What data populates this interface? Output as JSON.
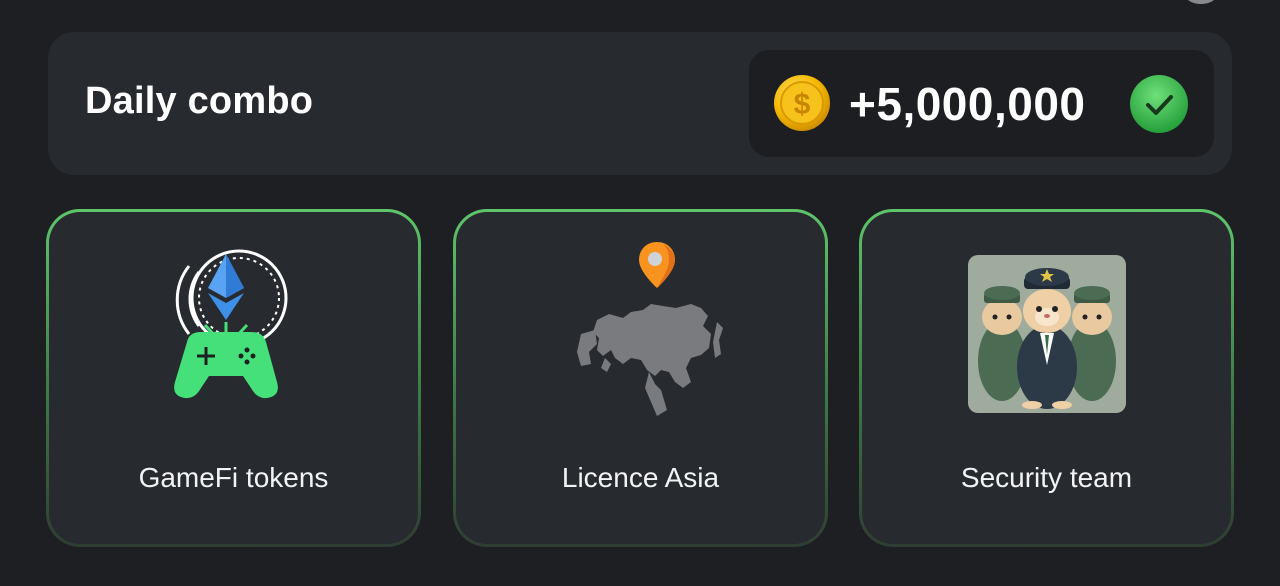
{
  "combo": {
    "title": "Daily combo",
    "reward": "+5,000,000",
    "completed": true
  },
  "cards": [
    {
      "label": "GameFi tokens",
      "icon": "gamefi-controller-icon"
    },
    {
      "label": "Licence Asia",
      "icon": "asia-map-icon"
    },
    {
      "label": "Security team",
      "icon": "hamster-security-team-image"
    }
  ],
  "colors": {
    "background": "#1d1f23",
    "panel": "#272a2f",
    "accent_green": "#5fc56a",
    "coin_gold": "#f5b800"
  }
}
